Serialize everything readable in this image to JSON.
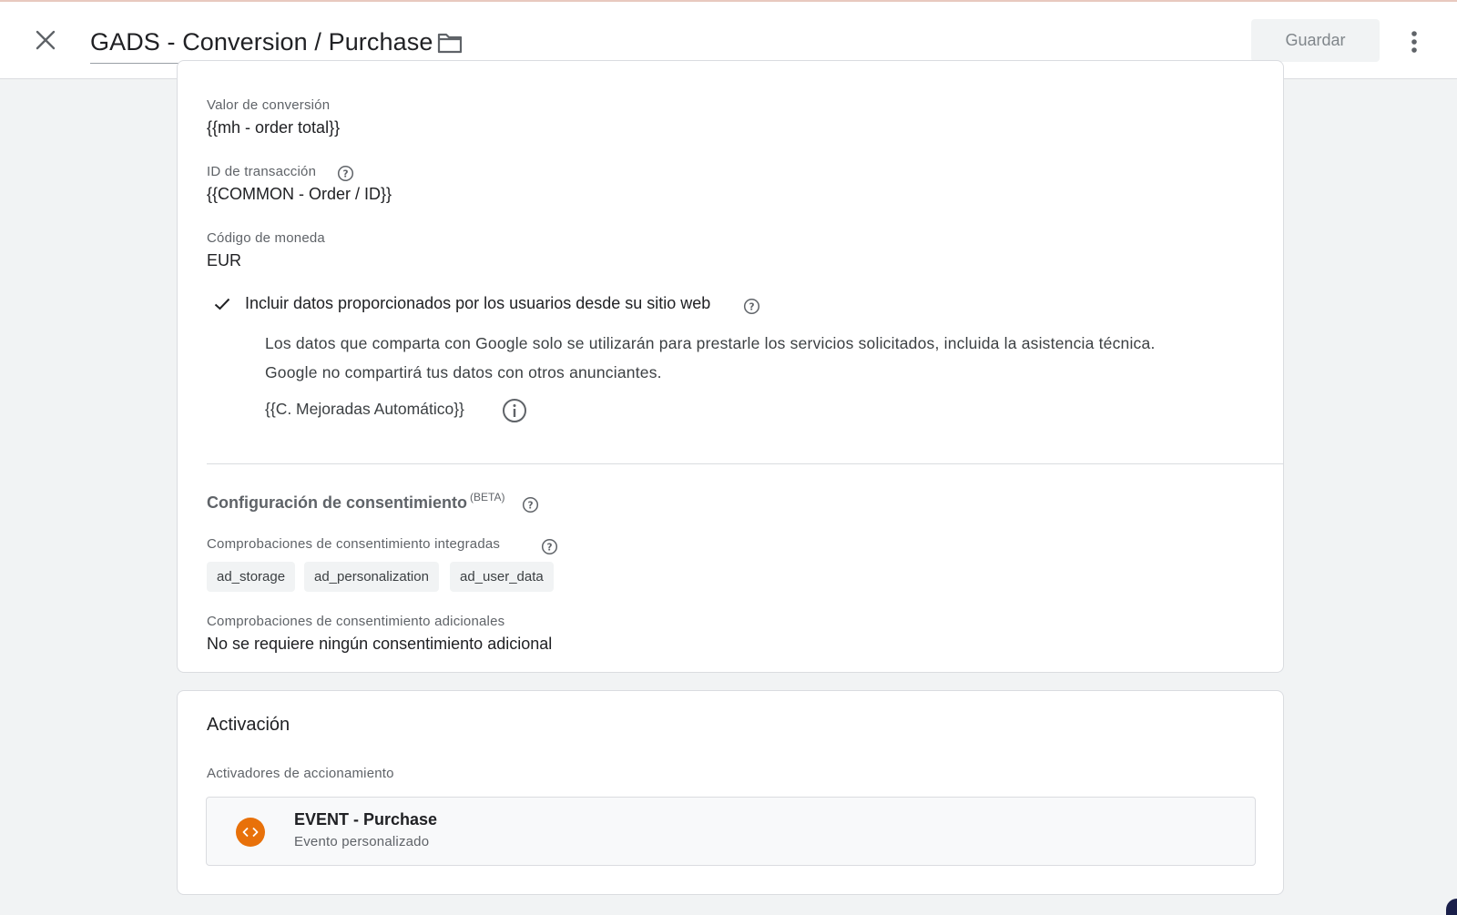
{
  "header": {
    "title": "GADS - Conversion / Purchase",
    "save_label": "Guardar"
  },
  "conversion": {
    "value_label": "Valor de conversión",
    "value": "{{mh - order total}}",
    "transaction_id_label": "ID de transacción",
    "transaction_id": "{{COMMON - Order / ID}}",
    "currency_label": "Código de moneda",
    "currency": "EUR",
    "user_data_label": "Incluir datos proporcionados por los usuarios desde su sitio web",
    "user_data_notice_line1": "Los datos que comparta con Google solo se utilizarán para prestarle los servicios solicitados, incluida la asistencia técnica.",
    "user_data_notice_line2": "Google no compartirá tus datos con otros anunciantes.",
    "user_data_variable": "{{C. Mejoradas Automático}}"
  },
  "consent": {
    "title": "Configuración de consentimiento",
    "badge": "(BETA)",
    "builtin_label": "Comprobaciones de consentimiento integradas",
    "builtin_checks": [
      "ad_storage",
      "ad_personalization",
      "ad_user_data"
    ],
    "additional_label": "Comprobaciones de consentimiento adicionales",
    "additional_value": "No se requiere ningún consentimiento adicional"
  },
  "triggering": {
    "title": "Activación",
    "firing_label": "Activadores de accionamiento",
    "trigger_name": "EVENT - Purchase",
    "trigger_type": "Evento personalizado"
  },
  "colors": {
    "trigger_icon": "#e8710a",
    "save_button_bg": "#f1f3f4",
    "page_bg": "#f1f3f4"
  },
  "icons": [
    "close-icon",
    "folder-icon",
    "more-vert-icon",
    "help-icon",
    "check-icon",
    "info-icon",
    "custom-event-icon"
  ]
}
